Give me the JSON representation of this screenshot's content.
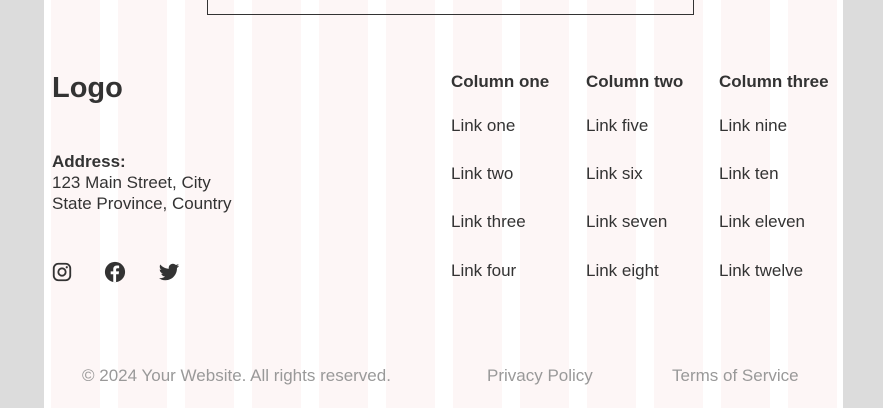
{
  "footer": {
    "logo": "Logo",
    "address": {
      "label": "Address:",
      "line1": "123 Main Street, City",
      "line2": "State Province, Country"
    },
    "social": [
      {
        "icon": "instagram-icon"
      },
      {
        "icon": "facebook-icon"
      },
      {
        "icon": "twitter-icon"
      }
    ],
    "columns": [
      {
        "title": "Column one",
        "links": [
          "Link one",
          "Link two",
          "Link three",
          "Link four"
        ]
      },
      {
        "title": "Column two",
        "links": [
          "Link five",
          "Link six",
          "Link seven",
          "Link eight"
        ]
      },
      {
        "title": "Column three",
        "links": [
          "Link nine",
          "Link ten",
          "Link eleven",
          "Link twelve"
        ]
      }
    ],
    "copyright": "© 2024 Your Website. All rights reserved.",
    "privacy": "Privacy Policy",
    "terms": "Terms of Service"
  },
  "colors": {
    "text": "#333333",
    "muted": "#999999",
    "page_bg": "#dcdcdc"
  }
}
